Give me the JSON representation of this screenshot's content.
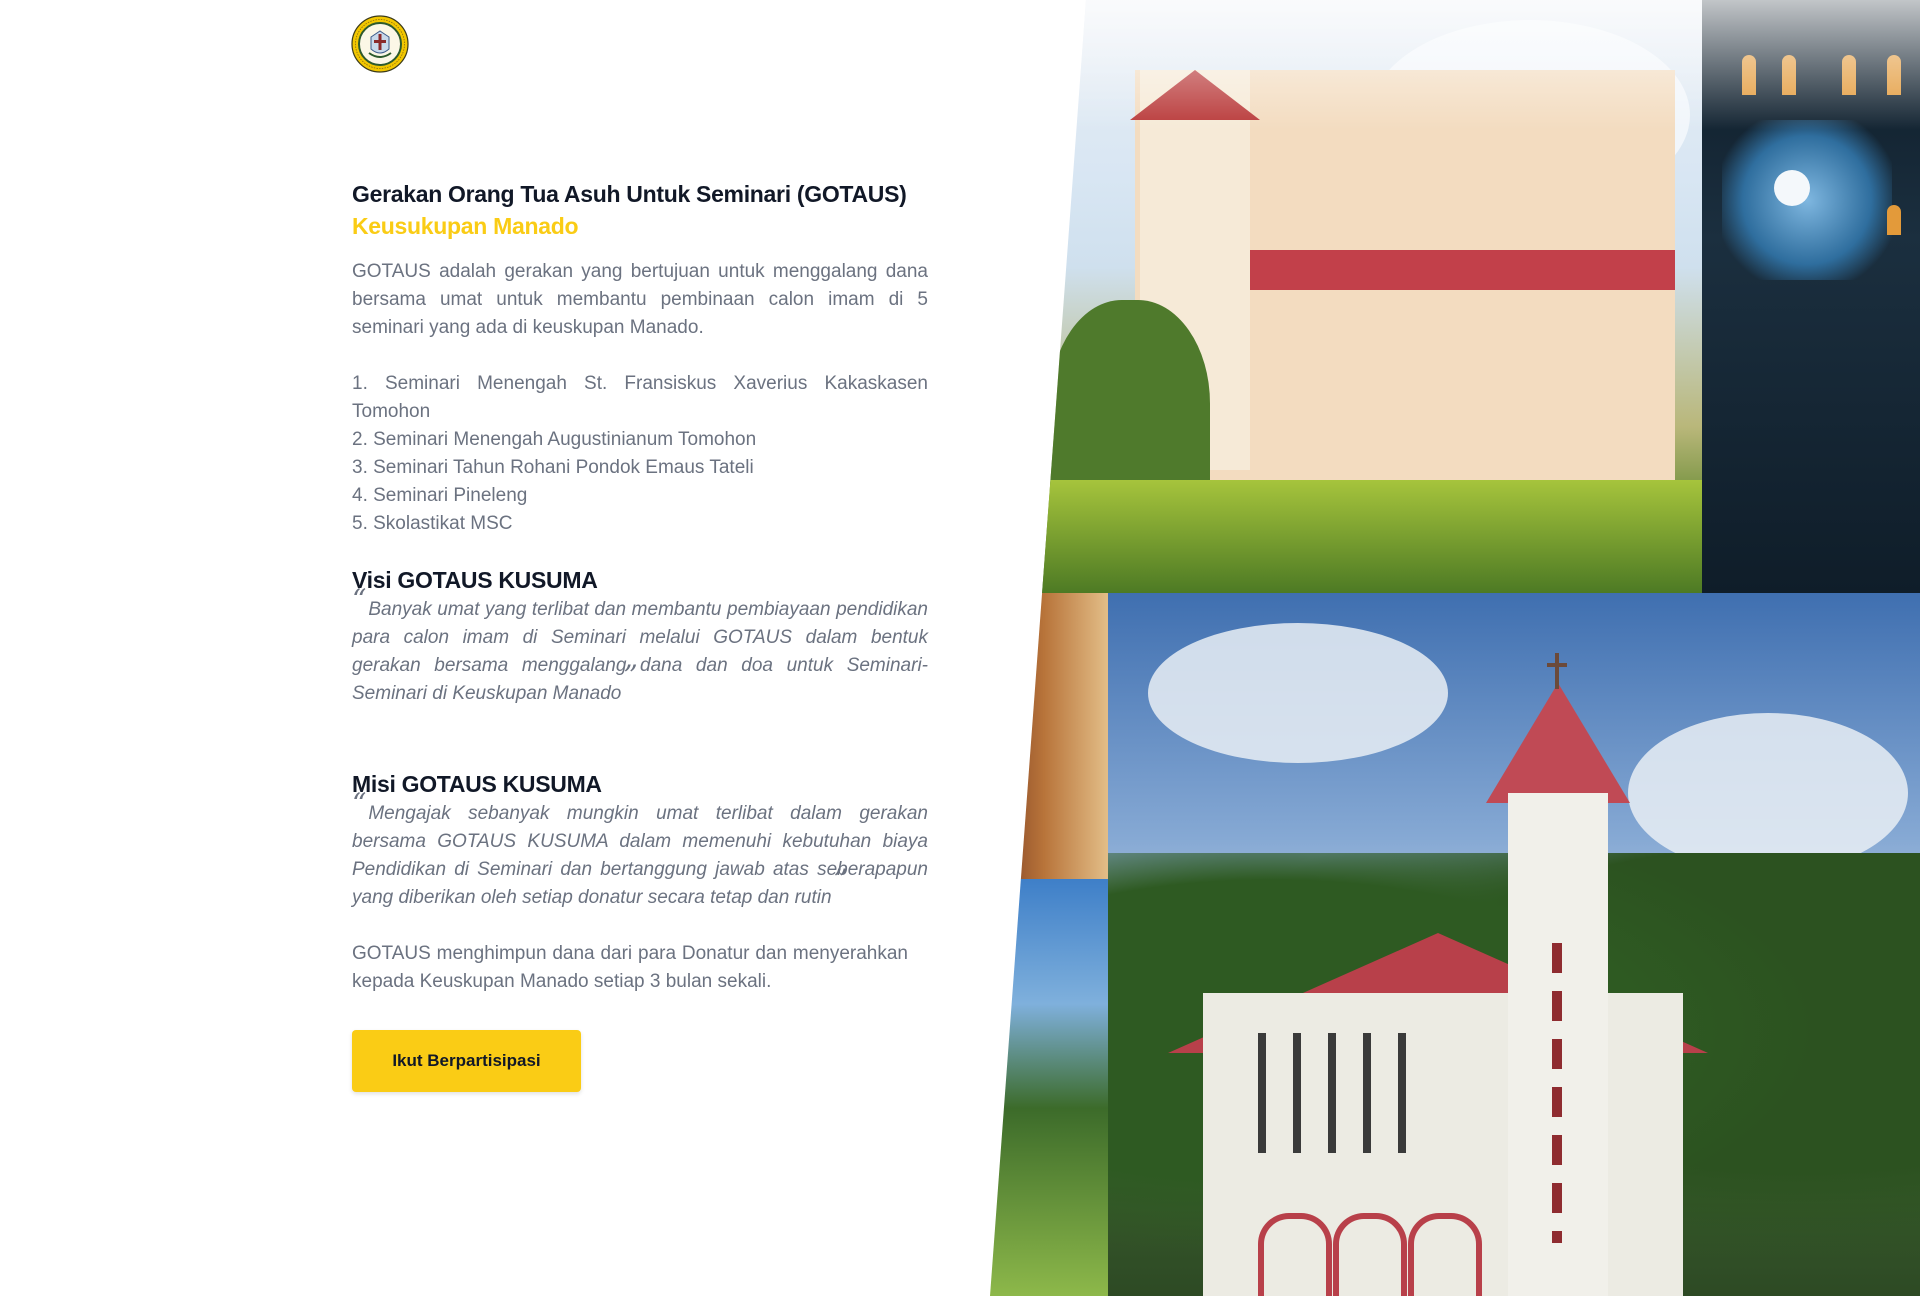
{
  "brand": {
    "logo_icon": "diocese-seal-icon",
    "accent_color": "#facc15",
    "heading_color": "#111827",
    "text_color": "#6b7280"
  },
  "hero": {
    "title": "Gerakan Orang Tua Asuh Untuk Seminari (GOTAUS)",
    "subtitle": "Keusukupan Manado",
    "intro": "GOTAUS adalah gerakan yang bertujuan untuk menggalang dana bersama umat untuk membantu pembinaan calon imam di 5 seminari yang ada di keuskupan Manado.",
    "seminaries": [
      "1. Seminari Menengah St. Fransiskus Xaverius Kakaskasen Tomohon",
      "2. Seminari Menengah Augustinianum Tomohon",
      "3. Seminari Tahun Rohani Pondok Emaus Tateli",
      "4. Seminari Pineleng",
      "5. Skolastikat MSC"
    ]
  },
  "visi": {
    "title": "Visi GOTAUS KUSUMA",
    "quote": "Banyak umat yang terlibat dan membantu pembiayaan pendidikan para calon imam di Seminari melalui GOTAUS dalam bentuk gerakan bersama menggalang dana dan doa untuk Seminari-Seminari di Keuskupan Manado"
  },
  "misi": {
    "title": "Misi GOTAUS KUSUMA",
    "quote": "Mengajak sebanyak mungkin umat terlibat dalam gerakan bersama GOTAUS KUSUMA dalam memenuhi kebutuhan biaya Pendidikan di Seminari dan bertanggung jawab atas seberapapun yang diberikan oleh setiap donatur secara tetap dan rutin"
  },
  "closing": "GOTAUS menghimpun dana dari para Donatur dan menyerahkan kepada Keuskupan Manado setiap 3 bulan sekali.",
  "cta": {
    "label": "Ikut Berpartisipasi"
  },
  "quote_marks": {
    "open": "“",
    "close": "”"
  }
}
